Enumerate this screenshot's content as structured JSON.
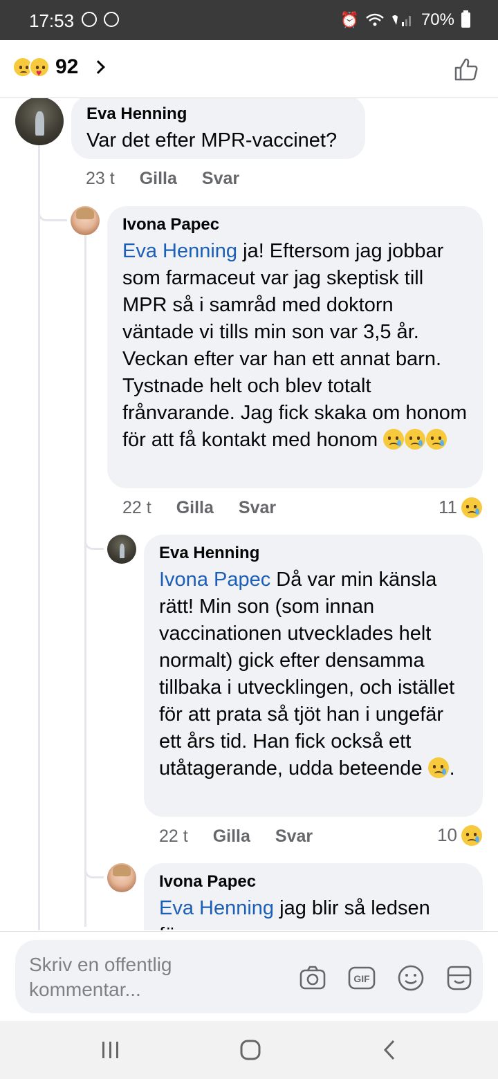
{
  "status_bar": {
    "time": "17:53",
    "battery": "70%"
  },
  "header": {
    "reaction_count": "92"
  },
  "comments": [
    {
      "author": "Eva Henning",
      "text": "Var det efter MPR-vaccinet?",
      "time": "23 t",
      "like": "Gilla",
      "reply": "Svar"
    },
    {
      "author": "Ivona Papec",
      "mention": "Eva Henning",
      "text": " ja! Eftersom jag jobbar som farmaceut var jag skeptisk till MPR så i samråd med doktorn väntade vi tills min son var 3,5 år. Veckan efter var han ett annat barn. Tystnade helt och blev totalt frånvarande. Jag fick skaka om honom för att få kontakt med honom ",
      "time": "22 t",
      "like": "Gilla",
      "reply": "Svar",
      "reactions": "11"
    },
    {
      "author": "Eva Henning",
      "mention": "Ivona Papec",
      "text": " Då var min känsla rätt! Min son (som innan vaccinationen utvecklades helt normalt) gick efter densamma tillbaka i utvecklingen, och istället för att prata så tjöt han i ungefär ett års tid. Han fick också ett utåtagerande, udda beteende ",
      "tail": ".",
      "time": "22 t",
      "like": "Gilla",
      "reply": "Svar",
      "reactions": "10"
    },
    {
      "author": "Ivona Papec",
      "mention": "Eva Henning",
      "text": " jag blir så ledsen för..."
    }
  ],
  "composer": {
    "placeholder": "Skriv en offentlig kommentar..."
  },
  "icons": {
    "camera": "camera-icon",
    "gif": "gif-icon",
    "emoji": "emoji-icon",
    "sticker": "sticker-icon"
  }
}
